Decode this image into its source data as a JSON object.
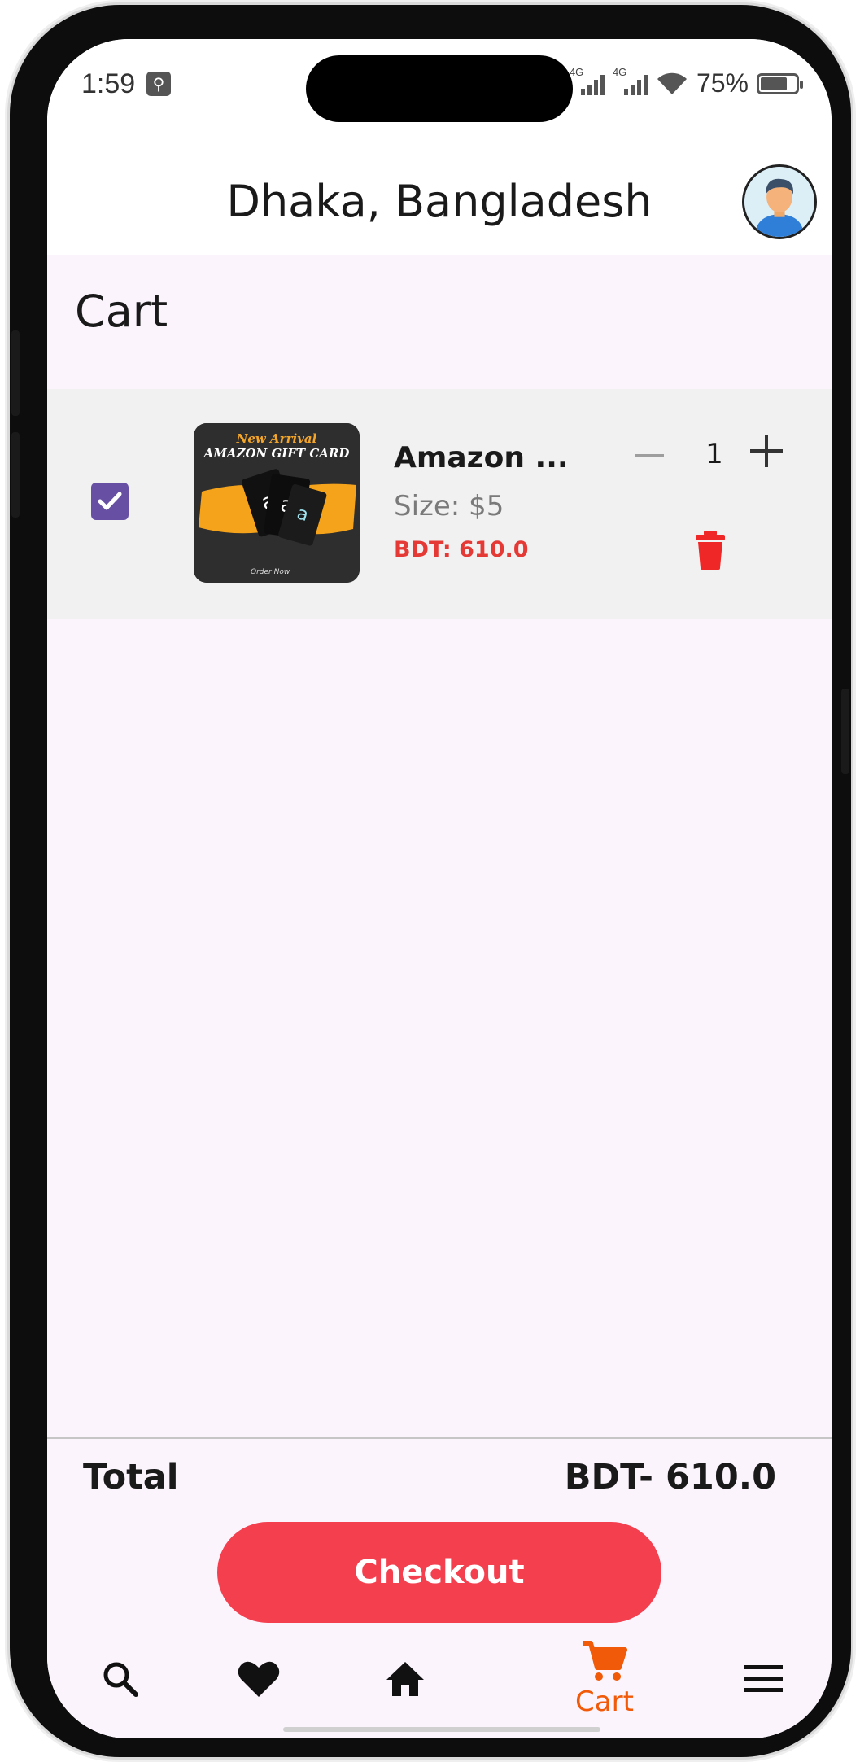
{
  "status_bar": {
    "time": "1:59",
    "signal_1_tag": "4G",
    "signal_2_tag": "4G",
    "battery": "75%"
  },
  "header": {
    "location": "Dhaka, Bangladesh",
    "avatar_icon": "user-avatar"
  },
  "page": {
    "title": "Cart"
  },
  "cart_items": [
    {
      "checked": true,
      "thumbnail_line_1": "New Arrival",
      "thumbnail_line_2": "AMAZON GIFT CARD",
      "thumbnail_footer": "Order Now",
      "name": "Amazon ...",
      "size": "Size: $5",
      "price": "BDT: 610.0",
      "quantity": "1"
    }
  ],
  "summary": {
    "total_label": "Total",
    "total_value": "BDT- 610.0",
    "checkout_label": "Checkout"
  },
  "bottom_nav": {
    "items": [
      {
        "icon": "search-icon",
        "label": ""
      },
      {
        "icon": "heart-icon",
        "label": ""
      },
      {
        "icon": "home-icon",
        "label": ""
      },
      {
        "icon": "cart-icon",
        "label": "Cart",
        "active": true
      },
      {
        "icon": "menu-icon",
        "label": ""
      }
    ]
  },
  "colors": {
    "accent": "#f15a08",
    "checkout": "#f43f4f",
    "price": "#e53935",
    "checkbox": "#6750a4",
    "background": "#fbf4fc"
  }
}
